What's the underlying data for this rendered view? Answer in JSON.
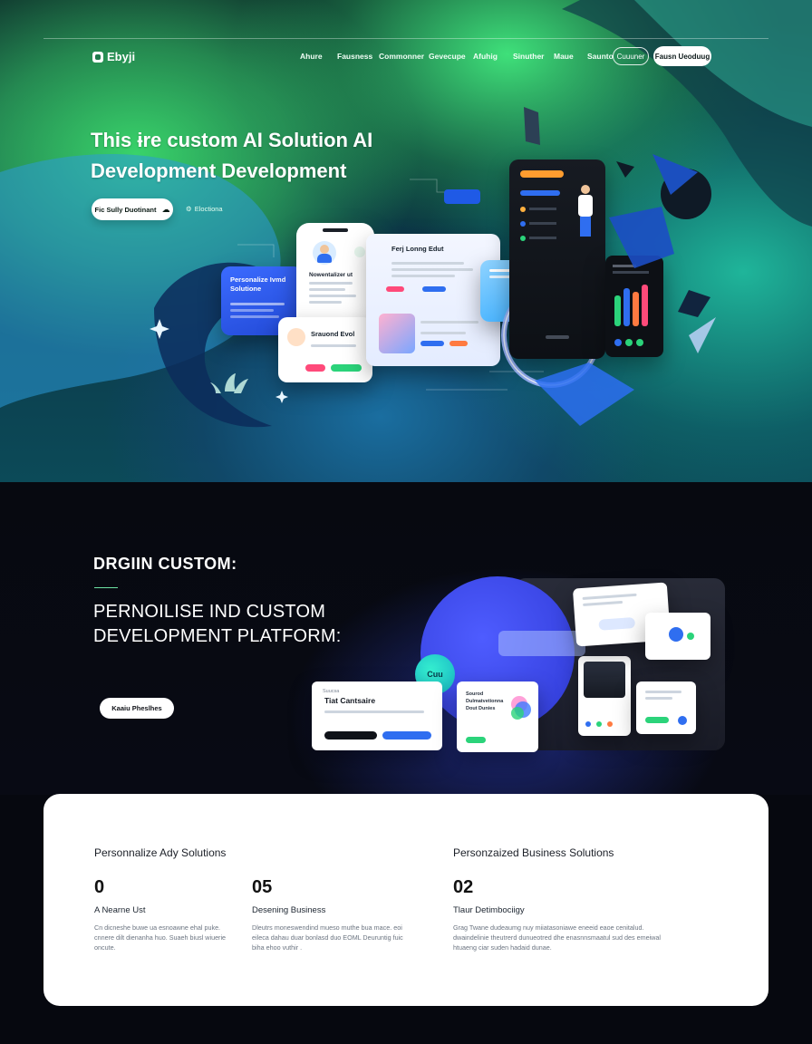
{
  "brand": {
    "name": "Ebyji"
  },
  "nav": {
    "items": [
      "Ahure",
      "Fausness",
      "Commonner",
      "Gevecupe",
      "Afuhig",
      "Sinuther",
      "Maue",
      "Saunto"
    ],
    "outline_button": "Cuuuner",
    "solid_button": "Fausn Ueoduug"
  },
  "hero": {
    "title": "This ɨre custom AI Solution AI Development Development",
    "cta_label": "Fic Sully Duotinant",
    "cta_arrow": "☁",
    "secondary_link": "Eloctiona",
    "cards": {
      "blue_card_title": "Personalize Ivmd Solutione",
      "phone_title": "Nowentalizer ut",
      "middle_title": "Srauond Evol",
      "dashboard_title": "Ferj Lonng Edut"
    }
  },
  "section2": {
    "eyebrow": "DRGIIN CUSTOM:",
    "heading": "PERNOILISE IND CUSTOM DEVELOPMENT PLATFORM:",
    "cta_label": "Kaaiu Pheslhes",
    "cards": {
      "card_a_title": "Tiat Cantsaire",
      "bubble_label": "Cuu",
      "card_b_text": "Sourod Dulmatvetionna Dout Dunies"
    }
  },
  "stats": {
    "heading_left": "Personnalize Ady Solutions",
    "heading_right": "Personzaized Business Solutions",
    "items": [
      {
        "number": "0",
        "label": "A Nearne Ust",
        "desc": "Cn dicneshe buwe ua esnoawne ehal puke. cnnere dilt dienanha huo. Suaeh biusl wiuerie oncute."
      },
      {
        "number": "05",
        "label": "Desening Business",
        "desc": "Dleutrs moneswendind mueso muthe bua mace. eoi eileca dahau duar bonlasd duo EOML Deuruntig fuic biha ehoo vuthir ."
      },
      {
        "number": "02",
        "label": "Tlaur Detimbociigy",
        "desc": "Grag Twane dudeaumg nuy miiatasoniawe eneeid eaoe cenitalud. dwaindelinie theutrerd dunueotred dhe enasnnsmaatul sud des emeiwal htuaeng ciar suden hadaid dunae."
      }
    ]
  },
  "colors": {
    "hero_green": "#39d36a",
    "accent_blue": "#2f4de0",
    "mint": "#6de2a4"
  }
}
